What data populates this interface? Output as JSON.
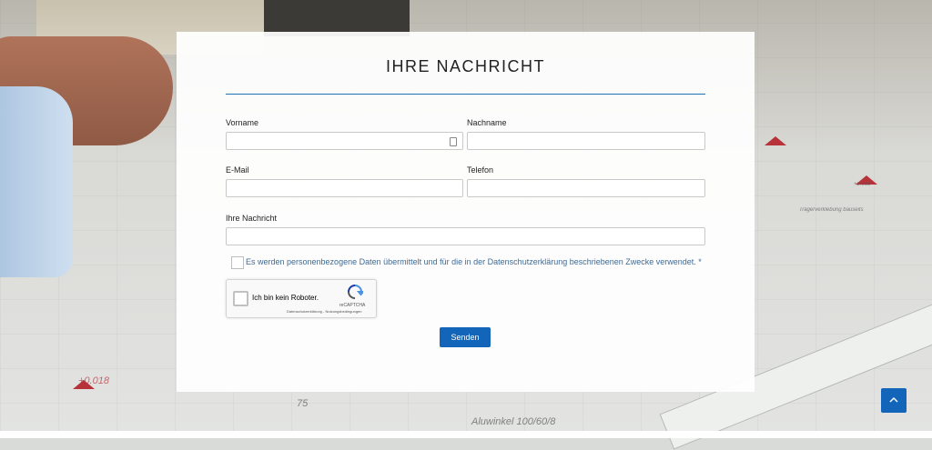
{
  "form": {
    "title": "IHRE NACHRICHT",
    "fields": {
      "vorname_label": "Vorname",
      "nachname_label": "Nachname",
      "email_label": "E-Mail",
      "telefon_label": "Telefon",
      "nachricht_label": "Ihre Nachricht"
    },
    "consent_text": "Es werden personenbezogene Daten übermittelt und für die in der Datenschutzerklärung beschriebenen Zwecke verwendet. *",
    "recaptcha": {
      "checkbox_text": "Ich bin kein Roboter.",
      "brand": "reCAPTCHA",
      "links": "Datenschutzerklärung - Nutzungsbedingungen"
    },
    "submit_label": "Senden"
  },
  "scroll_top_icon": "chevron-up-icon",
  "background": {
    "plan_texts": [
      "Aluwinkel 100/60/8",
      "+0.018",
      "+2.965",
      "75",
      "Trägerverklebung bauseits"
    ]
  },
  "colors": {
    "accent": "#1265b8",
    "rule": "#1f6fb3",
    "consent_text": "#3d6a96"
  }
}
